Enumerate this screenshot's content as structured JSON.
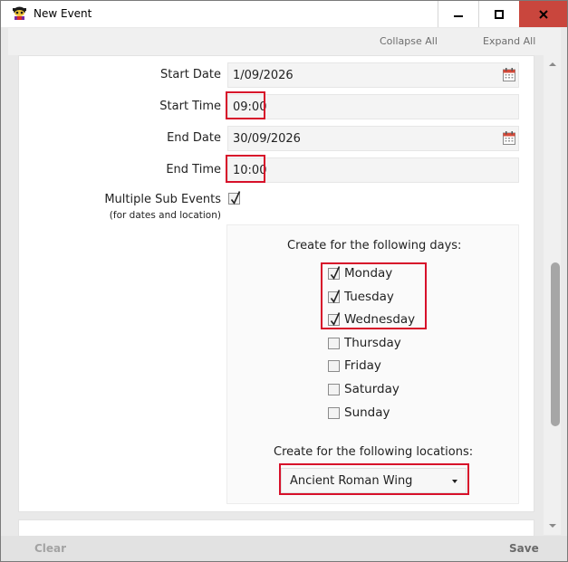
{
  "window": {
    "title": "New Event",
    "icon": "event-app-icon",
    "controls": [
      "minimize-icon",
      "maximize-icon",
      "close-icon"
    ]
  },
  "toolbar": {
    "collapse_all": "Collapse All",
    "expand_all": "Expand All"
  },
  "form": {
    "start_date_label": "Start Date",
    "start_date_value": "1/09/2026",
    "start_time_label": "Start Time",
    "start_time_value": "09:00",
    "end_date_label": "End Date",
    "end_date_value": "30/09/2026",
    "end_time_label": "End Time",
    "end_time_value": "10:00",
    "multiple_sub_events_label": "Multiple Sub Events",
    "multiple_sub_events_hint": "(for dates and location)",
    "multiple_sub_events_checked": true
  },
  "sub_events": {
    "days_heading": "Create for the following days:",
    "days": [
      {
        "label": "Monday",
        "checked": true
      },
      {
        "label": "Tuesday",
        "checked": true
      },
      {
        "label": "Wednesday",
        "checked": true
      },
      {
        "label": "Thursday",
        "checked": false
      },
      {
        "label": "Friday",
        "checked": false
      },
      {
        "label": "Saturday",
        "checked": false
      },
      {
        "label": "Sunday",
        "checked": false
      }
    ],
    "locations_heading": "Create for the following locations:",
    "location_selected": "Ancient Roman Wing"
  },
  "footer": {
    "clear_label": "Clear",
    "save_label": "Save"
  },
  "colors": {
    "highlight": "#d7102a",
    "close_button": "#c9463d"
  }
}
